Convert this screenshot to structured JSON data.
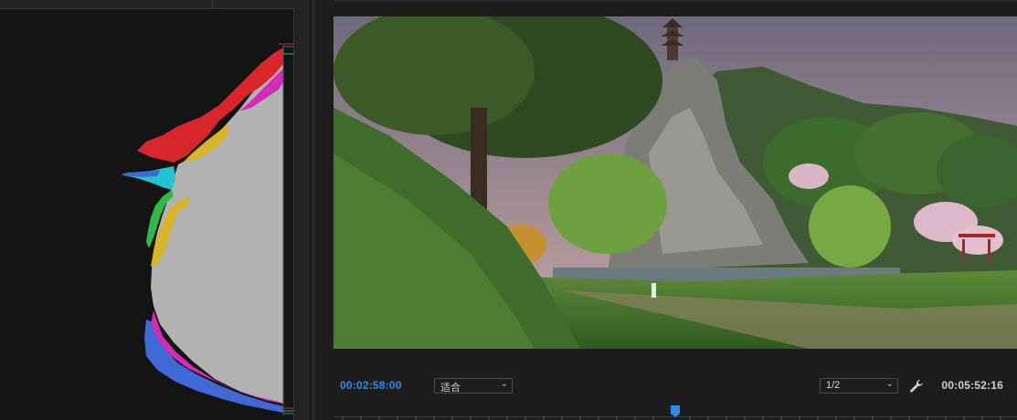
{
  "monitor": {
    "current_timecode": "00:02:58:00",
    "duration_timecode": "00:05:52:16",
    "zoom_select": {
      "value": "适合",
      "icon": "chevron-down-icon"
    },
    "resolution_select": {
      "value": "1/2",
      "icon": "chevron-down-icon"
    },
    "settings_icon": "wrench-icon",
    "playhead_icon": "playhead-marker-icon"
  },
  "scope": {
    "type": "rgb-parade-vectorscope-histogram",
    "colors": {
      "red": "#d9262c",
      "yellow": "#d7b429",
      "cyan": "#25c3cf",
      "green": "#32b848",
      "magenta": "#d62ab8",
      "blue": "#3f6ad6",
      "gray": "#b2b2b2"
    }
  },
  "colors": {
    "accent": "#2d8ceb",
    "panel_bg": "#1d1d1d",
    "scope_bg": "#141414"
  }
}
